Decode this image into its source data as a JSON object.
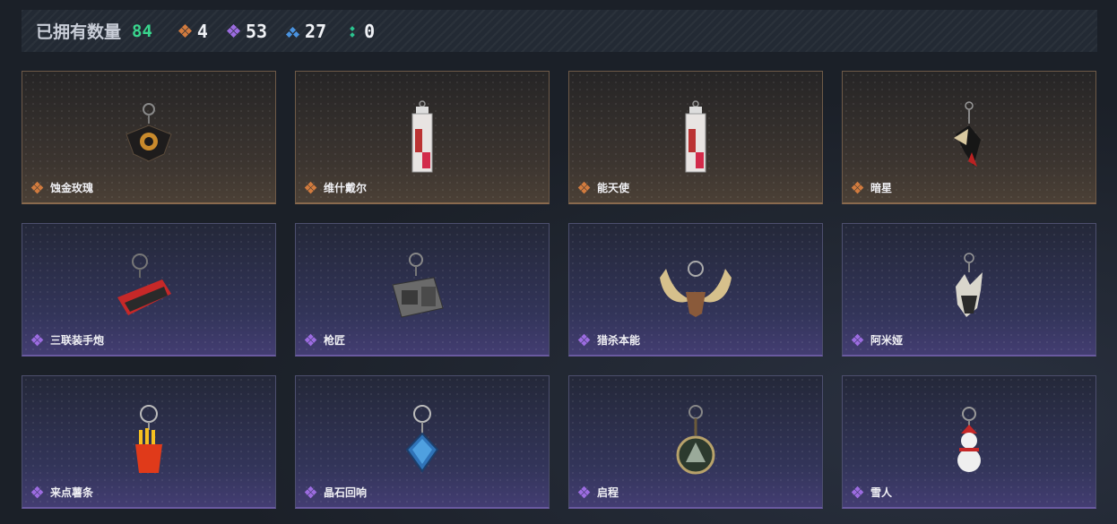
{
  "header": {
    "owned_label": "已拥有数量",
    "owned_count": "84",
    "stats": [
      {
        "rarity": "gold",
        "value": "4"
      },
      {
        "rarity": "purple",
        "value": "53"
      },
      {
        "rarity": "blue",
        "value": "27"
      },
      {
        "rarity": "green",
        "value": "0"
      }
    ]
  },
  "colors": {
    "owned_count": "#39d58d",
    "gold": "#d27b3e",
    "purple": "#9c6ce0",
    "blue": "#4a93e0",
    "green": "#2bc48f"
  },
  "items": [
    {
      "name": "蚀金玫瑰",
      "rarity": "gold",
      "icon": "rose-charm-icon"
    },
    {
      "name": "维什戴尔",
      "rarity": "gold",
      "icon": "card-charm-icon"
    },
    {
      "name": "能天使",
      "rarity": "gold",
      "icon": "card-charm-icon"
    },
    {
      "name": "暗星",
      "rarity": "gold",
      "icon": "dark-star-charm-icon"
    },
    {
      "name": "三联装手炮",
      "rarity": "purple",
      "icon": "hand-cannon-charm-icon"
    },
    {
      "name": "枪匠",
      "rarity": "purple",
      "icon": "gunsmith-charm-icon"
    },
    {
      "name": "猎杀本能",
      "rarity": "purple",
      "icon": "antler-charm-icon"
    },
    {
      "name": "阿米娅",
      "rarity": "purple",
      "icon": "amiya-charm-icon"
    },
    {
      "name": "来点薯条",
      "rarity": "purple",
      "icon": "fries-charm-icon"
    },
    {
      "name": "晶石回响",
      "rarity": "purple",
      "icon": "crystal-charm-icon"
    },
    {
      "name": "启程",
      "rarity": "purple",
      "icon": "medal-charm-icon"
    },
    {
      "name": "雪人",
      "rarity": "purple",
      "icon": "snowman-charm-icon"
    }
  ]
}
